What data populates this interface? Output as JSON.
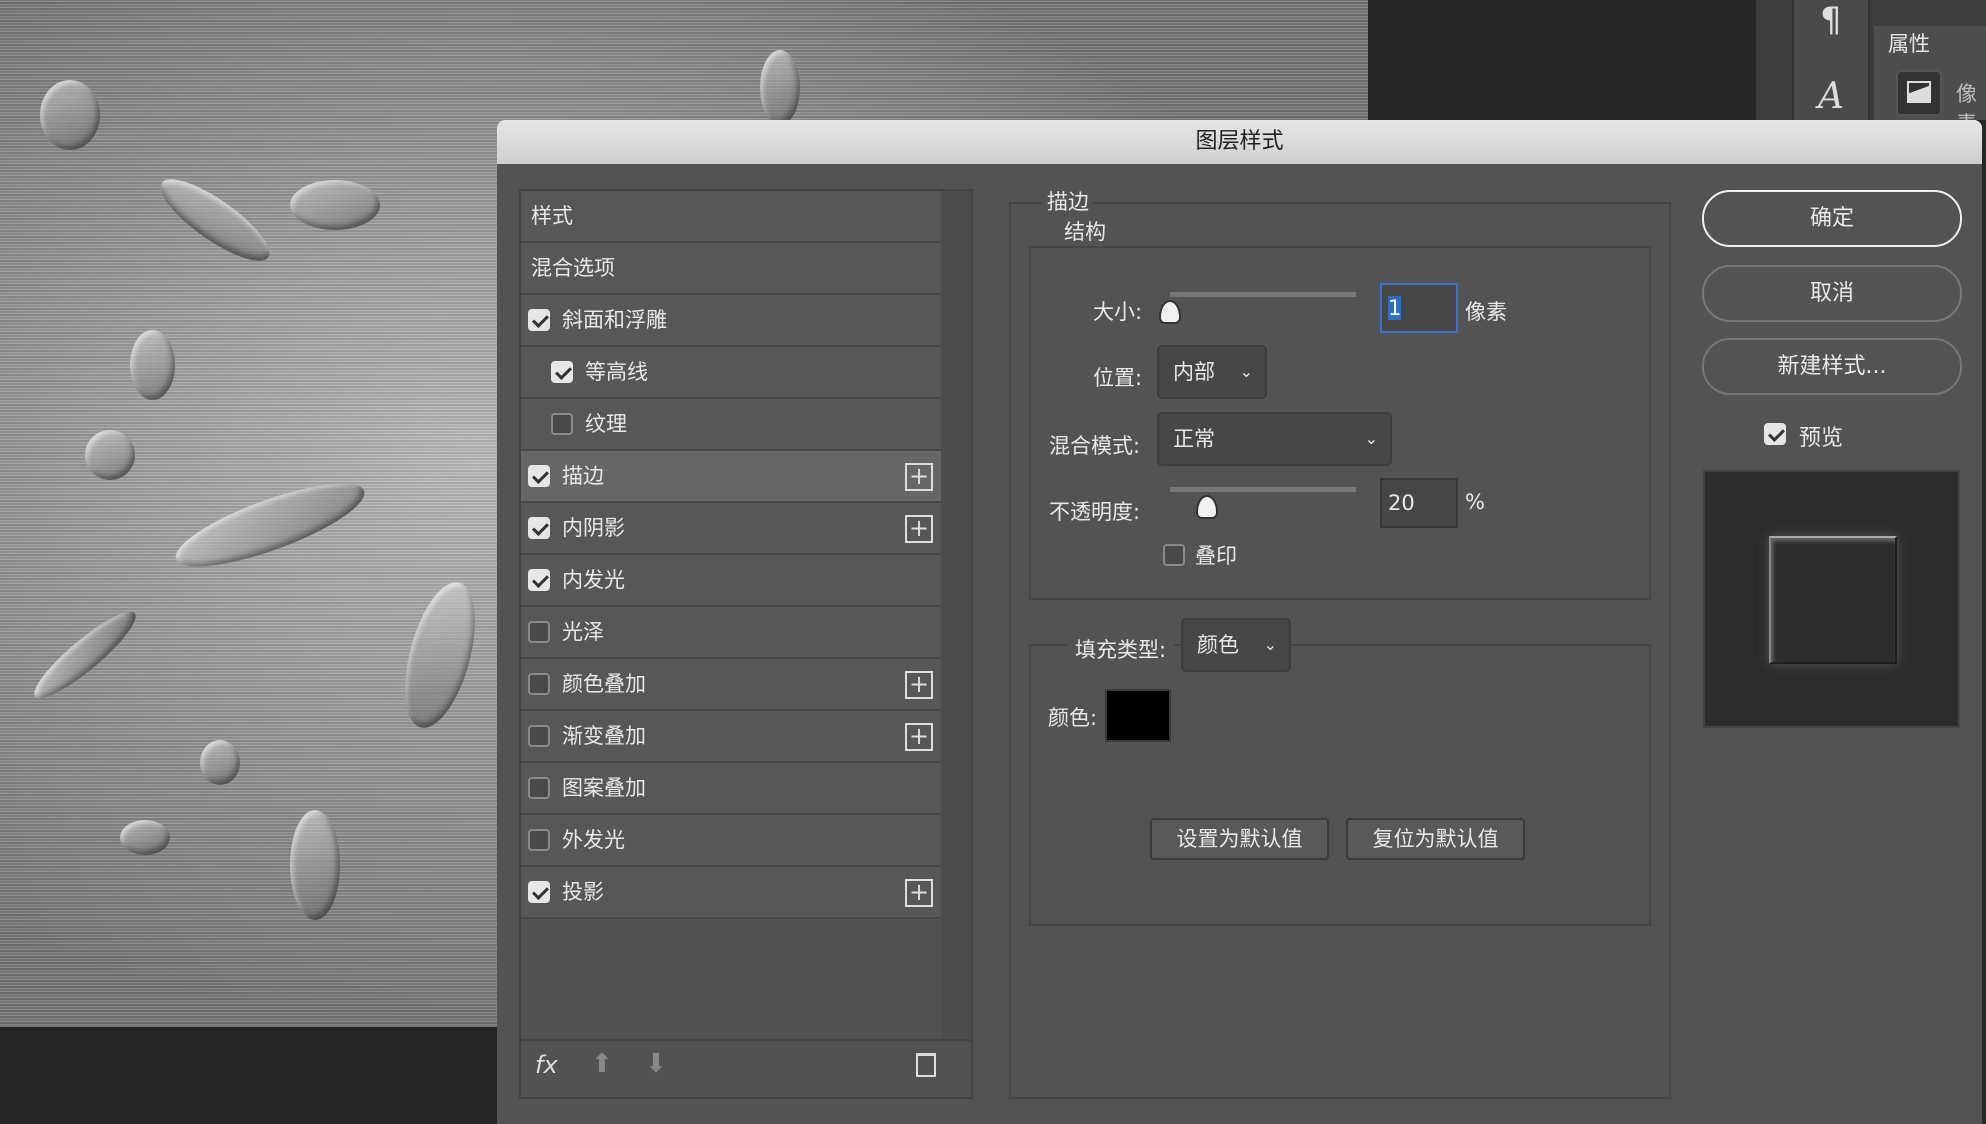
{
  "dialog": {
    "title": "图层样式"
  },
  "side_panel": {
    "tab": "属性",
    "item": "像素"
  },
  "styles": {
    "header": "样式",
    "blend_options": "混合选项",
    "items": [
      {
        "label": "斜面和浮雕",
        "checked": true,
        "indent": false,
        "plus": false,
        "selected": false
      },
      {
        "label": "等高线",
        "checked": true,
        "indent": true,
        "plus": false,
        "selected": false
      },
      {
        "label": "纹理",
        "checked": false,
        "indent": true,
        "plus": false,
        "selected": false
      },
      {
        "label": "描边",
        "checked": true,
        "indent": false,
        "plus": true,
        "selected": true
      },
      {
        "label": "内阴影",
        "checked": true,
        "indent": false,
        "plus": true,
        "selected": false
      },
      {
        "label": "内发光",
        "checked": true,
        "indent": false,
        "plus": false,
        "selected": false
      },
      {
        "label": "光泽",
        "checked": false,
        "indent": false,
        "plus": false,
        "selected": false
      },
      {
        "label": "颜色叠加",
        "checked": false,
        "indent": false,
        "plus": true,
        "selected": false
      },
      {
        "label": "渐变叠加",
        "checked": false,
        "indent": false,
        "plus": true,
        "selected": false
      },
      {
        "label": "图案叠加",
        "checked": false,
        "indent": false,
        "plus": false,
        "selected": false
      },
      {
        "label": "外发光",
        "checked": false,
        "indent": false,
        "plus": false,
        "selected": false
      },
      {
        "label": "投影",
        "checked": true,
        "indent": false,
        "plus": true,
        "selected": false
      }
    ],
    "plus_glyph": "+",
    "fx": "fx"
  },
  "stroke": {
    "title": "描边",
    "structure": "结构",
    "size_label": "大小:",
    "size_value": "1",
    "size_unit": "像素",
    "size_fraction": 0.0,
    "position_label": "位置:",
    "position_value": "内部",
    "blend_label": "混合模式:",
    "blend_value": "正常",
    "opacity_label": "不透明度:",
    "opacity_value": "20",
    "opacity_unit": "%",
    "opacity_percent": 20,
    "overprint_label": "叠印",
    "overprint_checked": false,
    "fill_type_label": "填充类型:",
    "fill_type_value": "颜色",
    "color_label": "颜色:",
    "color": "#000000",
    "set_default": "设置为默认值",
    "reset_default": "复位为默认值"
  },
  "actions": {
    "ok": "确定",
    "cancel": "取消",
    "new_style": "新建样式...",
    "preview_label": "预览",
    "preview_checked": true
  }
}
